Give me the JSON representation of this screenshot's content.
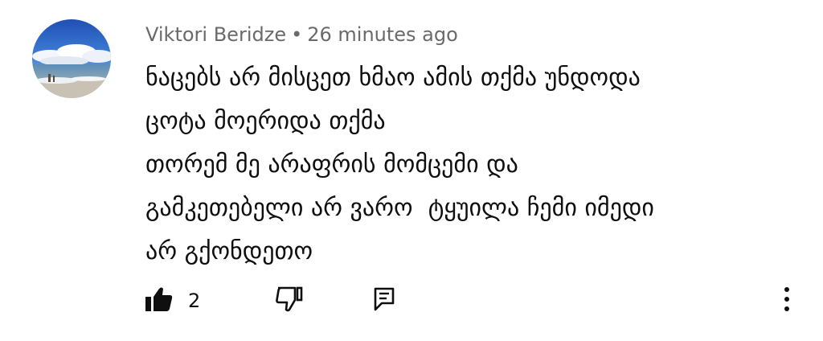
{
  "comment": {
    "author": "Viktori Beridze",
    "separator": "•",
    "timestamp": "26 minutes ago",
    "lines": [
      "ნაცებს არ მისცეთ ხმაო ამის თქმა უნდოდა",
      "ცოტა მოერიდა თქმა",
      "თორემ მე არაფრის მომცემი და",
      "გამკეთებელი არ ვარო  ტყუილა ჩემი იმედი",
      "არ გქონდეთო"
    ],
    "like_count": "2"
  },
  "icons": {
    "avatar": "avatar-beach-photo",
    "like": "thumbs-up-icon",
    "dislike": "thumbs-down-icon",
    "reply": "reply-comment-icon",
    "more": "more-vertical-icon"
  },
  "colors": {
    "text": "#0f0f0f",
    "meta": "#6a6a6a",
    "background": "#ffffff"
  }
}
